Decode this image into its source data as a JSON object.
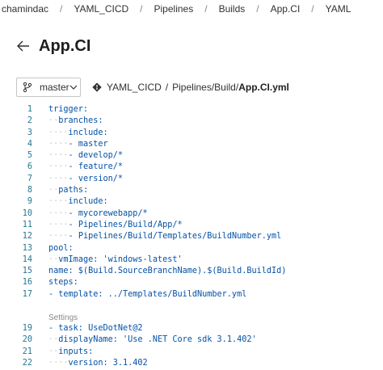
{
  "breadcrumb": [
    "chamindac",
    "YAML_CICD",
    "Pipelines",
    "Builds",
    "App.CI",
    "YAML"
  ],
  "page": {
    "title": "App.CI"
  },
  "branch": {
    "name": "master"
  },
  "path": {
    "repo": "YAML_CICD",
    "dir": "Pipelines/Build/",
    "file": "App.CI.yml"
  },
  "settings_label": "Settings",
  "code_lines": [
    {
      "num": "1",
      "dots": "",
      "text": "trigger:"
    },
    {
      "num": "2",
      "dots": "··",
      "text": "branches:"
    },
    {
      "num": "3",
      "dots": "····",
      "text": "include:"
    },
    {
      "num": "4",
      "dots": "····",
      "text": "- master"
    },
    {
      "num": "5",
      "dots": "····",
      "text": "- develop/*"
    },
    {
      "num": "6",
      "dots": "····",
      "text": "- feature/*"
    },
    {
      "num": "7",
      "dots": "····",
      "text": "- version/*"
    },
    {
      "num": "8",
      "dots": "··",
      "text": "paths:"
    },
    {
      "num": "9",
      "dots": "····",
      "text": "include:"
    },
    {
      "num": "10",
      "dots": "····",
      "text": "- mycorewebapp/*"
    },
    {
      "num": "11",
      "dots": "····",
      "text": "- Pipelines/Build/App/*"
    },
    {
      "num": "12",
      "dots": "····",
      "text": "- Pipelines/Build/Templates/BuildNumber.yml"
    },
    {
      "num": "13",
      "dots": "",
      "text": "pool:"
    },
    {
      "num": "14",
      "dots": "··",
      "text": "vmImage: 'windows-latest'"
    },
    {
      "num": "15",
      "dots": "",
      "text": "name: $(Build.SourceBranchName).$(Build.BuildId)"
    },
    {
      "num": "16",
      "dots": "",
      "text": "steps:"
    },
    {
      "num": "17",
      "dots": "",
      "text": "- template: ../Templates/BuildNumber.yml"
    }
  ],
  "code_lines_2": [
    {
      "num": "19",
      "dots": "",
      "text": "- task: UseDotNet@2"
    },
    {
      "num": "20",
      "dots": "··",
      "text": "displayName: 'Use .NET Core sdk 3.1.402'"
    },
    {
      "num": "21",
      "dots": "··",
      "text": "inputs:"
    },
    {
      "num": "22",
      "dots": "····",
      "text": "version: 3.1.402"
    }
  ]
}
